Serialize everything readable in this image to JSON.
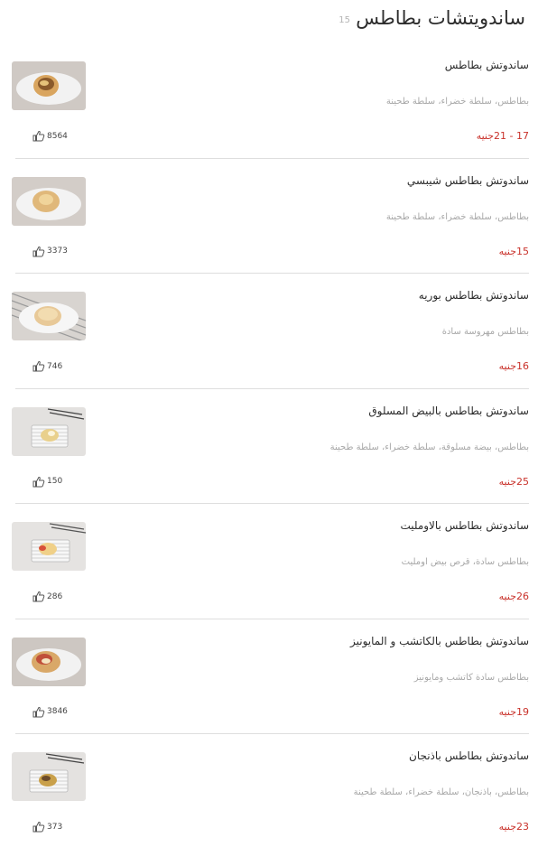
{
  "header": {
    "title": "ساندويتشات بطاطس",
    "count": "15"
  },
  "icons": {
    "like": "thumbs-up-icon"
  },
  "colors": {
    "price": "#c9322b",
    "description": "#a8a8a8",
    "divider": "#dedede"
  },
  "items": [
    {
      "name": "ساندوتش بطاطس",
      "description": "بطاطس، سلطة خضراء، سلطة طحينة",
      "price": "17 - 21جنيه",
      "likes": "8564"
    },
    {
      "name": "ساندوتش بطاطس شيبسي",
      "description": "بطاطس، سلطة خضراء، سلطة طحينة",
      "price": "15جنيه",
      "likes": "3373"
    },
    {
      "name": "ساندوتش بطاطس بوريه",
      "description": "بطاطس مهروسة سادة",
      "price": "16جنيه",
      "likes": "746"
    },
    {
      "name": "ساندوتش بطاطس بالبيض المسلوق",
      "description": "بطاطس، بيضة مسلوقة، سلطة خضراء، سلطة طحينة",
      "price": "25جنيه",
      "likes": "150"
    },
    {
      "name": "ساندوتش بطاطس بالاومليت",
      "description": "بطاطس سادة، قرص بيض اومليت",
      "price": "26جنيه",
      "likes": "286"
    },
    {
      "name": "ساندوتش بطاطس بالكاتشب و المايونيز",
      "description": "بطاطس سادة كاتشب ومايونيز",
      "price": "19جنيه",
      "likes": "3846"
    },
    {
      "name": "ساندوتش بطاطس باذنجان",
      "description": "بطاطس، باذنجان، سلطة خضراء، سلطة طحينة",
      "price": "23جنيه",
      "likes": "373"
    }
  ]
}
